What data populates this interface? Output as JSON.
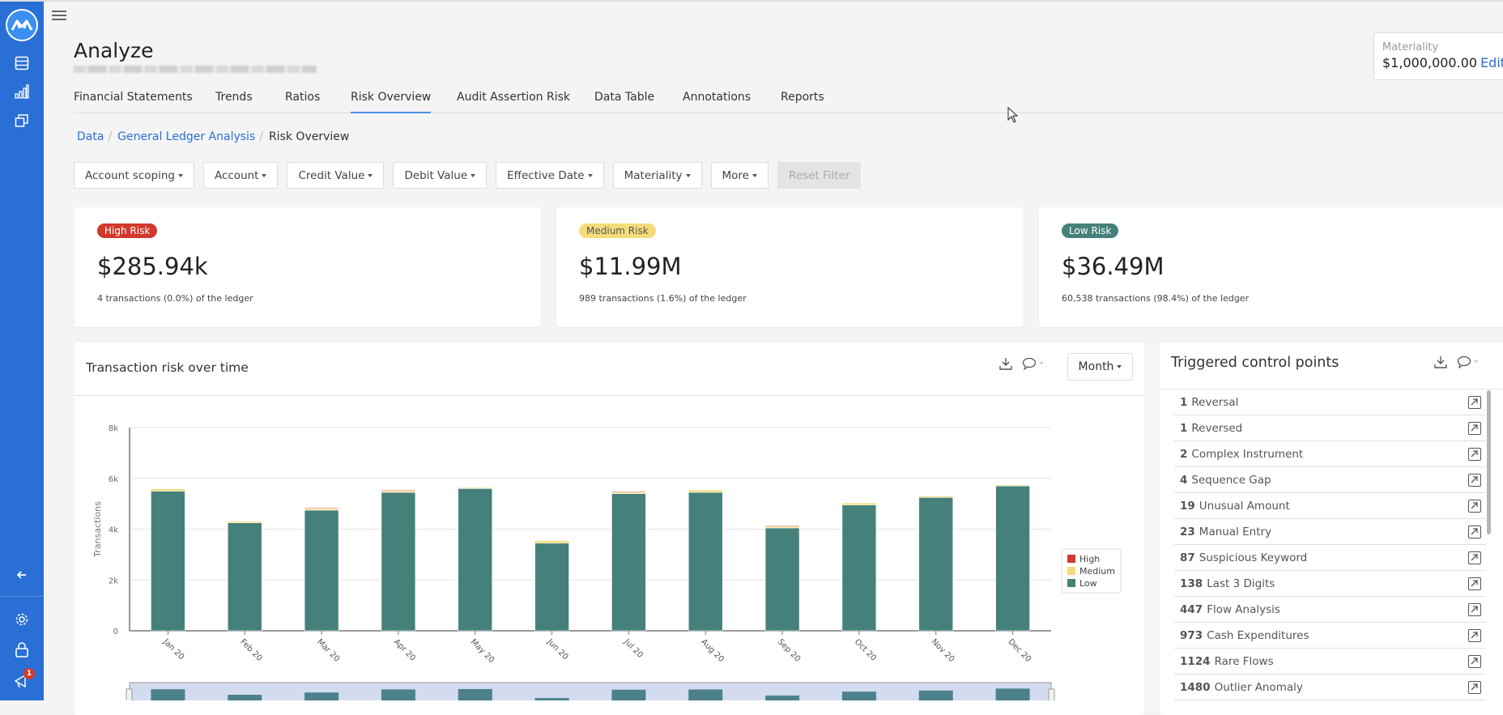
{
  "app": {
    "title": "Analyze",
    "notification_count": "1"
  },
  "sidebar": {
    "icons": [
      "logo-icon",
      "database-icon",
      "bar-chart-icon",
      "windows-icon",
      "collapse-arrow-icon",
      "gear-icon",
      "lock-icon",
      "megaphone-icon"
    ]
  },
  "materiality": {
    "label": "Materiality",
    "value": "$1,000,000.00",
    "edit_label": "Edit"
  },
  "tabs": [
    {
      "label": "Financial Statements",
      "active": false
    },
    {
      "label": "Trends",
      "active": false
    },
    {
      "label": "Ratios",
      "active": false
    },
    {
      "label": "Risk Overview",
      "active": true
    },
    {
      "label": "Audit Assertion Risk",
      "active": false
    },
    {
      "label": "Data Table",
      "active": false
    },
    {
      "label": "Annotations",
      "active": false
    },
    {
      "label": "Reports",
      "active": false
    }
  ],
  "breadcrumb": [
    {
      "label": "Data",
      "link": true
    },
    {
      "label": "General Ledger Analysis",
      "link": true
    },
    {
      "label": "Risk Overview",
      "link": false
    }
  ],
  "filters": [
    {
      "label": "Account scoping"
    },
    {
      "label": "Account"
    },
    {
      "label": "Credit Value"
    },
    {
      "label": "Debit Value"
    },
    {
      "label": "Effective Date"
    },
    {
      "label": "Materiality"
    },
    {
      "label": "More"
    }
  ],
  "reset_filter_label": "Reset Filter",
  "risk_cards": [
    {
      "badge": "High Risk",
      "amount": "$285.94k",
      "desc": "4 transactions (0.0%) of the ledger",
      "color": "#d0392b",
      "text_color": "#ffffff"
    },
    {
      "badge": "Medium Risk",
      "amount": "$11.99M",
      "desc": "989 transactions (1.6%) of the ledger",
      "color": "#f5dc7a",
      "text_color": "#555555"
    },
    {
      "badge": "Low Risk",
      "amount": "$36.49M",
      "desc": "60,538 transactions (98.4%) of the ledger",
      "color": "#45817a",
      "text_color": "#ffffff"
    }
  ],
  "risk_panel": {
    "title": "Transaction risk over time",
    "period_label": "Month"
  },
  "control_points": {
    "title": "Triggered control points",
    "items": [
      {
        "count": "1",
        "label": "Reversal"
      },
      {
        "count": "1",
        "label": "Reversed"
      },
      {
        "count": "2",
        "label": "Complex Instrument"
      },
      {
        "count": "4",
        "label": "Sequence Gap"
      },
      {
        "count": "19",
        "label": "Unusual Amount"
      },
      {
        "count": "23",
        "label": "Manual Entry"
      },
      {
        "count": "87",
        "label": "Suspicious Keyword"
      },
      {
        "count": "138",
        "label": "Last 3 Digits"
      },
      {
        "count": "447",
        "label": "Flow Analysis"
      },
      {
        "count": "973",
        "label": "Cash Expenditures"
      },
      {
        "count": "1124",
        "label": "Rare Flows"
      },
      {
        "count": "1480",
        "label": "Outlier Anomaly"
      }
    ]
  },
  "chart_data": {
    "type": "bar",
    "stacked": true,
    "title": "Transaction risk over time",
    "xlabel": "",
    "ylabel": "Transactions",
    "ylim": [
      0,
      8000
    ],
    "yticks": [
      0,
      2000,
      4000,
      6000,
      8000
    ],
    "ytick_labels": [
      "0",
      "2k",
      "4k",
      "6k",
      "8k"
    ],
    "categories": [
      "Jan 20",
      "Feb 20",
      "Mar 20",
      "Apr 20",
      "May 20",
      "Jun 20",
      "Jul 20",
      "Aug 20",
      "Sep 20",
      "Oct 20",
      "Nov 20",
      "Dec 20"
    ],
    "series": [
      {
        "name": "Low",
        "color": "#45817a",
        "values": [
          5500,
          4250,
          4750,
          5450,
          5600,
          3450,
          5400,
          5450,
          4050,
          4950,
          5250,
          5700
        ]
      },
      {
        "name": "Medium",
        "color": "#f5dc7a",
        "values": [
          90,
          60,
          90,
          90,
          40,
          100,
          80,
          90,
          90,
          80,
          50,
          40
        ]
      },
      {
        "name": "High",
        "color": "#d0392b",
        "values": [
          0,
          0,
          1,
          1,
          0,
          0,
          1,
          0,
          1,
          0,
          0,
          0
        ]
      }
    ],
    "legend": {
      "position": "right",
      "entries": [
        "High",
        "Medium",
        "Low"
      ]
    },
    "grid": true,
    "navigator": true
  }
}
